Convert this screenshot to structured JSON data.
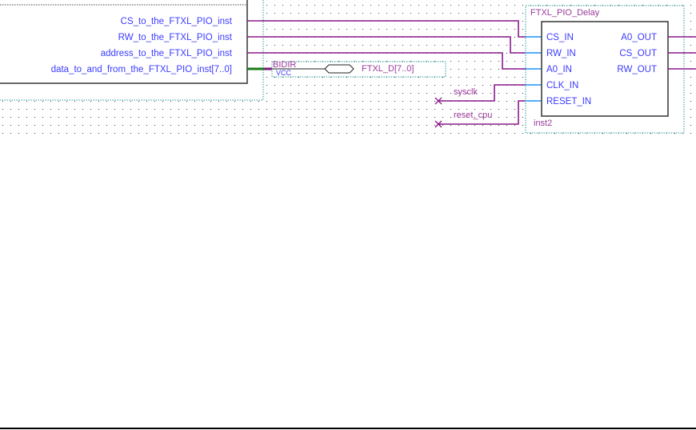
{
  "left_block": {
    "ports": [
      "CS_to_the_FTXL_PIO_inst",
      "RW_to_the_FTXL_PIO_inst",
      "address_to_the_FTXL_PIO_inst",
      "data_to_and_from_the_FTXL_PIO_inst[7..0]"
    ]
  },
  "bidir_pin": {
    "type": "BIDIR",
    "default": "VCC",
    "name": "FTXL_D[7..0]"
  },
  "nets": {
    "sysclk": "sysclk",
    "reset_cpu": "reset_cpu"
  },
  "delay_block": {
    "title": "FTXL_PIO_Delay",
    "instance": "inst2",
    "inputs": [
      "CS_IN",
      "RW_IN",
      "A0_IN",
      "CLK_IN",
      "RESET_IN"
    ],
    "outputs": [
      "A0_OUT",
      "CS_OUT",
      "RW_OUT"
    ]
  },
  "colors": {
    "wire": "#8a1a8a",
    "bus": "#1a7a1a",
    "port_text": "#3b3bff",
    "pin_stub": "#1e90ff",
    "frame": "#2a9a9a"
  }
}
